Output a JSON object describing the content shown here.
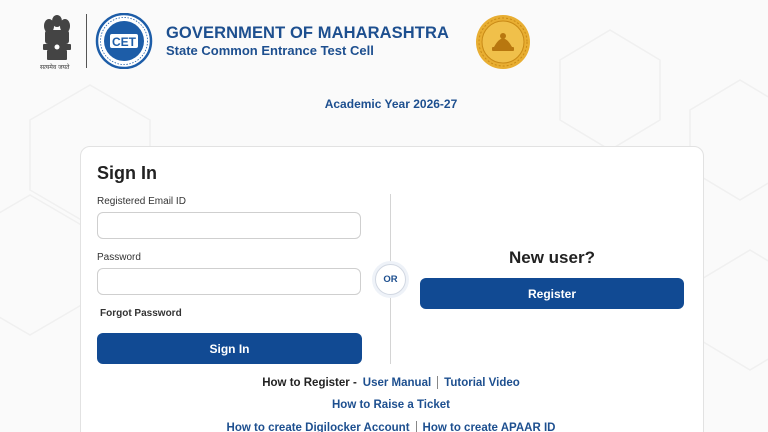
{
  "header": {
    "title": "GOVERNMENT OF MAHARASHTRA",
    "subtitle": "State Common Entrance Test Cell",
    "emblem_motto": "सत्यमेव जयते"
  },
  "academic_year": "Academic Year 2026-27",
  "signin": {
    "heading": "Sign In",
    "email_label": "Registered Email ID",
    "email_value": "",
    "password_label": "Password",
    "password_value": "",
    "forgot_label": "Forgot Password",
    "button_label": "Sign In"
  },
  "or_label": "OR",
  "newuser": {
    "heading": "New user?",
    "button_label": "Register"
  },
  "help": {
    "how_to_register": "How to Register -",
    "user_manual": "User Manual",
    "tutorial_video": "Tutorial Video",
    "raise_ticket": "How to Raise a Ticket",
    "digilocker": "How to create Digilocker Account",
    "apaar": "How to create APAAR ID"
  },
  "colors": {
    "brand_blue": "#114a93",
    "heading_blue": "#1d4f8f",
    "seal_gold": "#e5a92a"
  },
  "icons": [
    "national-emblem-icon",
    "cet-cell-logo-icon",
    "maharashtra-seal-icon"
  ]
}
